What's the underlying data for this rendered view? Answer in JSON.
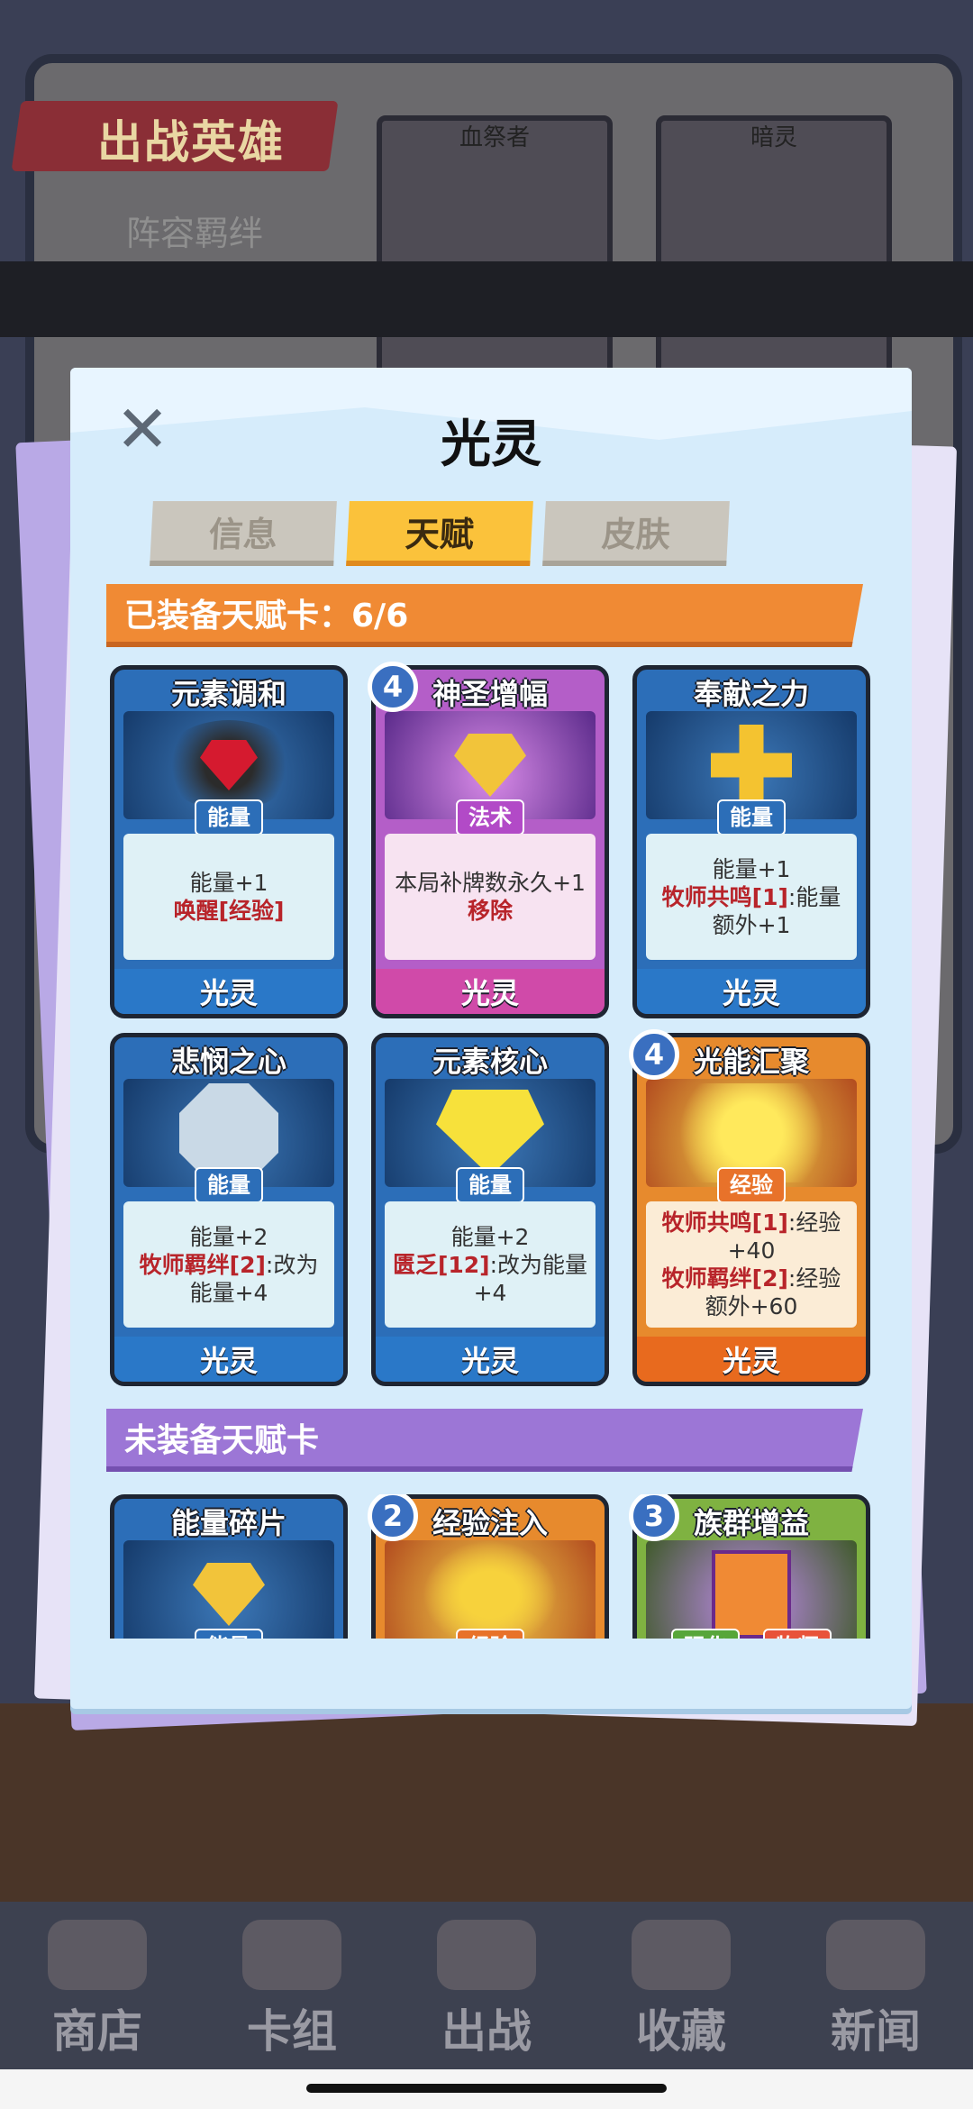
{
  "background": {
    "banner_title": "出战英雄",
    "bond_label": "阵容羁绊",
    "hero_columns": [
      "血祭者",
      "暗灵"
    ],
    "bottom_tabs": [
      {
        "label": "商店",
        "icon": "shop-icon"
      },
      {
        "label": "卡组",
        "icon": "deck-icon"
      },
      {
        "label": "出战",
        "icon": "battle-icon"
      },
      {
        "label": "收藏",
        "icon": "collection-icon"
      },
      {
        "label": "新闻",
        "icon": "news-icon"
      }
    ]
  },
  "modal": {
    "title": "光灵",
    "close_icon": "close-icon",
    "tabs": [
      {
        "label": "信息",
        "active": false
      },
      {
        "label": "天赋",
        "active": true
      },
      {
        "label": "皮肤",
        "active": false
      }
    ],
    "equipped_header": "已装备天赋卡：6/6",
    "unequipped_header": "未装备天赋卡",
    "equipped_cards": [
      {
        "title": "元素调和",
        "type": "能量",
        "color": "blue",
        "cost": null,
        "line1": "能量+1",
        "line2_red": "唤醒[经验]",
        "line2_rest": "",
        "footer": "光灵",
        "art": "red-gem-dark-swirl"
      },
      {
        "title": "神圣增幅",
        "type": "法术",
        "color": "purple",
        "cost": "4",
        "line1": "本局补牌数永久+1",
        "line2_red": "移除",
        "line2_rest": "",
        "footer": "光灵",
        "art": "golden-gem-lightning"
      },
      {
        "title": "奉献之力",
        "type": "能量",
        "color": "blue",
        "cost": null,
        "line1": "能量+1",
        "line2_red": "牧师共鸣[1]",
        "line2_rest": ":能量额外+1",
        "footer": "光灵",
        "art": "golden-cross"
      },
      {
        "title": "悲悯之心",
        "type": "能量",
        "color": "blue",
        "cost": null,
        "line1": "能量+2",
        "line2_red": "牧师羁绊[2]",
        "line2_rest": ":改为能量+4",
        "footer": "光灵",
        "art": "ice-heart"
      },
      {
        "title": "元素核心",
        "type": "能量",
        "color": "blue",
        "cost": null,
        "line1": "能量+2",
        "line2_red": "匮乏[12]",
        "line2_rest": ":改为能量+4",
        "footer": "光灵",
        "art": "yellow-crystal"
      },
      {
        "title": "光能汇聚",
        "type": "经验",
        "color": "orange",
        "cost": "4",
        "line1_red": "牧师共鸣[1]",
        "line1_rest": ":经验+40",
        "line2_red": "牧师羁绊[2]",
        "line2_rest": ":经验额外+60",
        "footer": "光灵",
        "art": "golden-burst"
      }
    ],
    "unequipped_cards": [
      {
        "title": "能量碎片",
        "type": "能量",
        "color": "blue",
        "cost": null
      },
      {
        "title": "经验注入",
        "type": "经验",
        "color": "orange",
        "cost": "2"
      },
      {
        "title": "族群增益",
        "type": "强化",
        "type2": "牧师",
        "color": "green",
        "cost": "3"
      }
    ]
  }
}
